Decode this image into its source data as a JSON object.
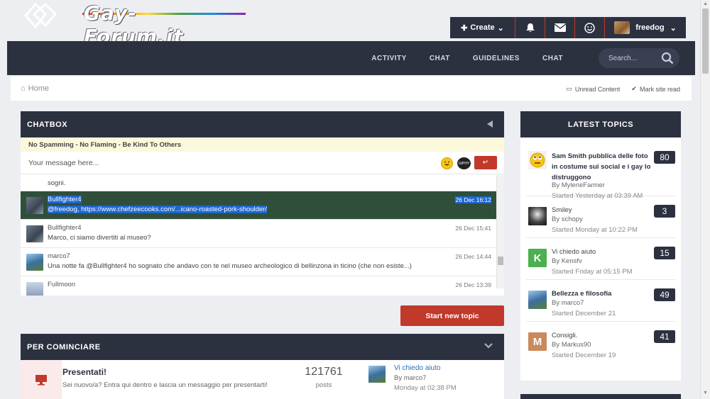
{
  "header": {
    "logo_text": "Gay-Forum.it",
    "create_label": "Create",
    "username": "freedog"
  },
  "nav": {
    "links": [
      "ACTIVITY",
      "CHAT",
      "GUIDELINES",
      "CHAT"
    ],
    "search_placeholder": "Search..."
  },
  "breadcrumb": {
    "home": "Home",
    "unread": "Unread Content",
    "mark_read": "Mark site read"
  },
  "chatbox": {
    "title": "CHATBOX",
    "rules": "No Spamming - No Flaming - Be Kind To Others",
    "input_placeholder": "Your message here...",
    "gif_label": "GIPHY",
    "prev_fragment": "sogni.",
    "messages": [
      {
        "user": "Bullfighter4",
        "text": "@freedog, https://www.chefzeecooks.com/...icano-roasted-pork-shoulder/",
        "time": "26 Dec 16:12"
      },
      {
        "user": "Bullfighter4",
        "text": "Marco, ci siamo divertiti al museo?",
        "time": "26 Dec 15:41"
      },
      {
        "user": "marco7",
        "text": "Una notte fa @Bullfighter4 ho sognato che andavo con te nel museo archeologico di bellinzona in ticino (che non esiste...)",
        "time": "26 Dec 14:44"
      },
      {
        "user": "Fullmoon",
        "text": "",
        "time": "26 Dec 13:39"
      }
    ]
  },
  "start_topic": "Start new topic",
  "forum_section": {
    "title": "PER COMINCIARE",
    "forum": {
      "name": "Presentati!",
      "description": "Sei nuovo/a? Entra qui dentro e lascia un messaggio per presentarti!",
      "post_count": "121761",
      "post_label": "posts",
      "last_title": "Vi chiedo aiuto",
      "last_by": "By marco7",
      "last_date": "Monday at 02:38 PM"
    }
  },
  "latest_topics": {
    "title": "LATEST TOPICS",
    "items": [
      {
        "title": "Sam Smith pubblica delle foto in costume sui social e i gay lo distruggono",
        "by": "By MyleneFarmer",
        "date": "Started Yesterday at 03:39 AM",
        "count": "80",
        "bold": true,
        "avatar": "emoji"
      },
      {
        "title": "Smiley",
        "by": "By schopy",
        "date": "Started Monday at 10:22 PM",
        "count": "3",
        "bold": false,
        "avatar": "photo-dark"
      },
      {
        "title": "Vi chiedo aiuto",
        "by": "By Kensfv",
        "date": "Started Friday at 05:15 PM",
        "count": "15",
        "bold": false,
        "avatar": "K"
      },
      {
        "title": "Bellezza e filosofia",
        "by": "By marco7",
        "date": "Started December 21",
        "count": "49",
        "bold": true,
        "avatar": "photo-peacock"
      },
      {
        "title": "Consigli.",
        "by": "By Markus90",
        "date": "Started December 19",
        "count": "41",
        "bold": false,
        "avatar": "M"
      }
    ]
  },
  "colors": {
    "dark": "#2c3140",
    "accent": "#c0392b",
    "selection": "#1e66d0",
    "avatar_k": "#4caf50",
    "avatar_m": "#c98a5e"
  }
}
